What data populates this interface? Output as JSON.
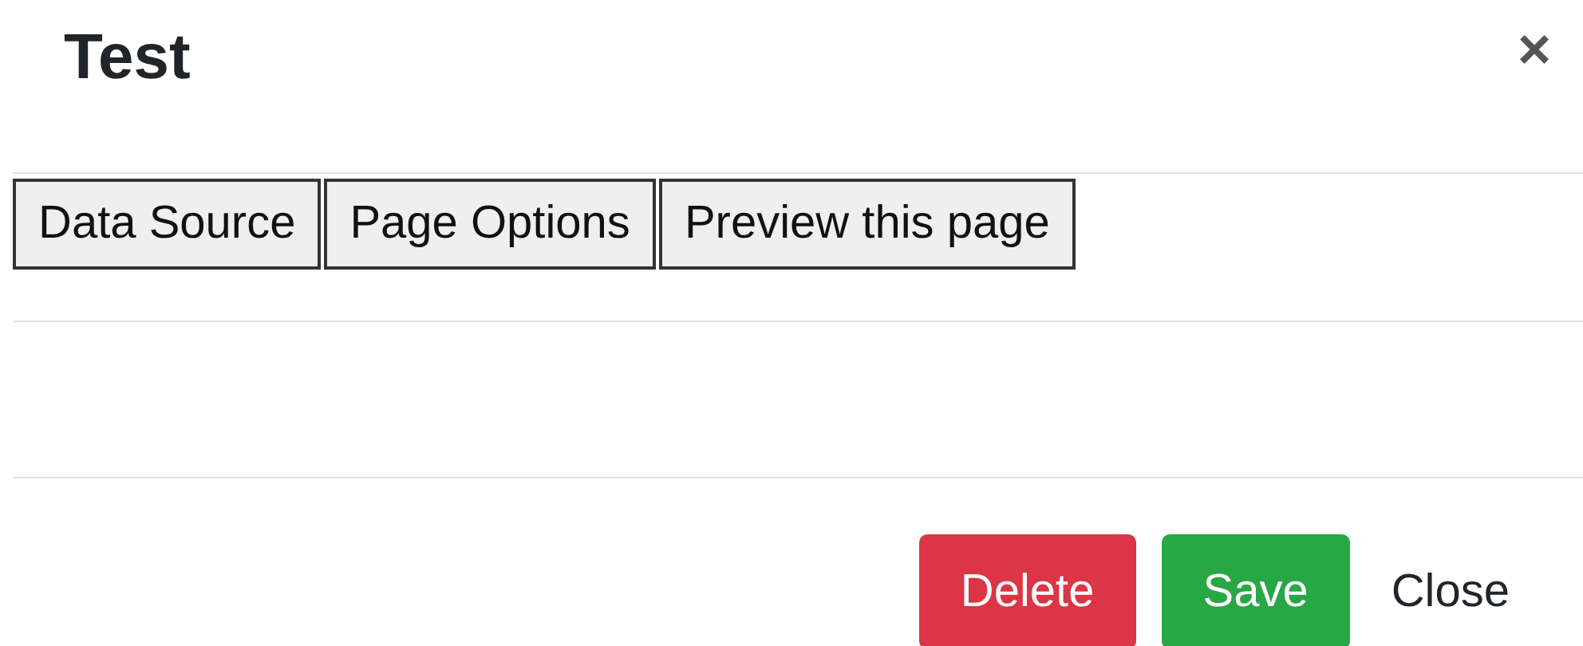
{
  "dialog": {
    "title": "Test",
    "close_icon": "×"
  },
  "tabs": [
    {
      "label": "Data Source"
    },
    {
      "label": "Page Options"
    },
    {
      "label": "Preview this page"
    }
  ],
  "footer": {
    "buttons": [
      {
        "label": "Delete",
        "kind": "danger"
      },
      {
        "label": "Save",
        "kind": "success"
      },
      {
        "label": "Close",
        "kind": "link"
      }
    ]
  }
}
